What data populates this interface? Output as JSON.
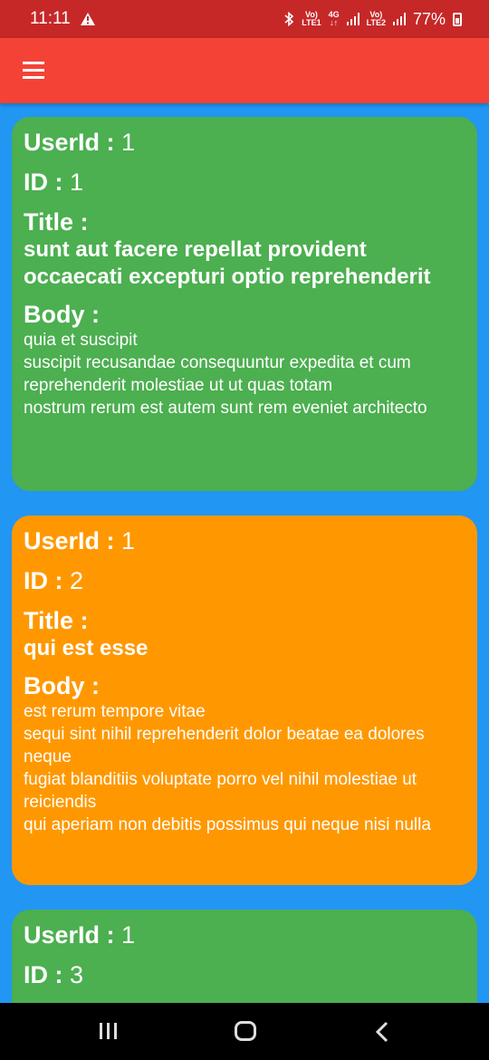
{
  "status_bar": {
    "time": "11:11",
    "net1_top": "Vo)",
    "net1_bottom": "LTE1",
    "net2_top": "4G",
    "net2_bottom": "↓↑",
    "net3_top": "Vo)",
    "net3_bottom": "LTE2",
    "battery": "77%"
  },
  "app_bar": {
    "menu_icon": "menu-icon"
  },
  "colors": {
    "green": "#4CAF50",
    "orange": "#FF9800",
    "blue": "#2196F3",
    "red": "#F44336"
  },
  "posts": [
    {
      "userid_label": "UserId :",
      "userid": "1",
      "id_label": "ID :",
      "id": "1",
      "title_label": "Title :",
      "title": "sunt aut facere repellat provident occaecati excepturi optio reprehenderit",
      "body_label": "Body :",
      "body": "quia et suscipit\nsuscipit recusandae consequuntur expedita et cum\nreprehenderit molestiae ut ut quas totam\nnostrum rerum est autem sunt rem eveniet architecto"
    },
    {
      "userid_label": "UserId :",
      "userid": "1",
      "id_label": "ID :",
      "id": "2",
      "title_label": "Title :",
      "title": "qui est esse",
      "body_label": "Body :",
      "body": "est rerum tempore vitae\nsequi sint nihil reprehenderit dolor beatae ea dolores neque\nfugiat blanditiis voluptate porro vel nihil molestiae ut reiciendis\nqui aperiam non debitis possimus qui neque nisi nulla"
    },
    {
      "userid_label": "UserId :",
      "userid": "1",
      "id_label": "ID :",
      "id": "3"
    }
  ]
}
